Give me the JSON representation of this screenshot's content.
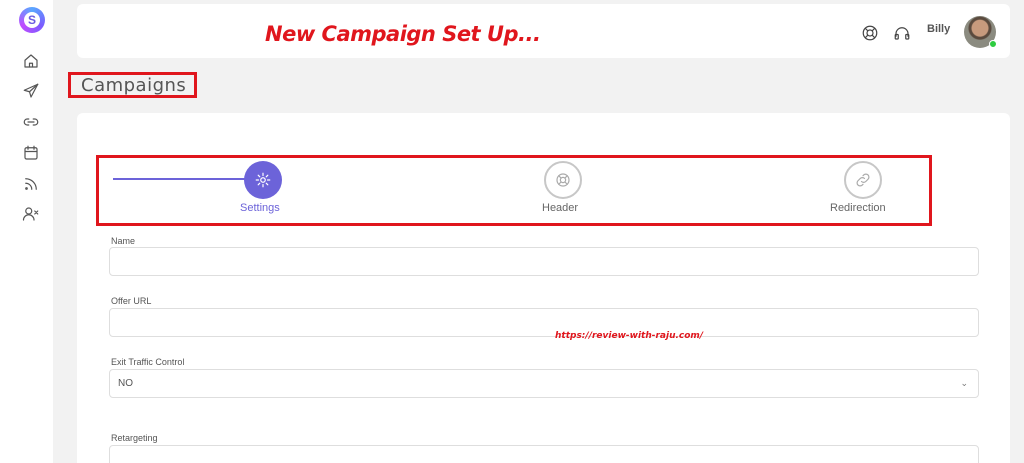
{
  "logo": {
    "glyph": "S"
  },
  "sidebar": {
    "items": [
      {
        "name": "home-icon"
      },
      {
        "name": "send-icon"
      },
      {
        "name": "link-icon"
      },
      {
        "name": "calendar-icon"
      },
      {
        "name": "rss-icon"
      },
      {
        "name": "user-x-icon"
      }
    ]
  },
  "topbar": {
    "banner": "New Campaign Set Up...",
    "username": "Billy"
  },
  "page": {
    "title": "Campaigns"
  },
  "stepper": {
    "steps": [
      {
        "label": "Settings",
        "icon": "gear-icon",
        "active": true
      },
      {
        "label": "Header",
        "icon": "lifebuoy-icon",
        "active": false
      },
      {
        "label": "Redirection",
        "icon": "link-icon",
        "active": false
      }
    ]
  },
  "form": {
    "name_label": "Name",
    "name_value": "",
    "offer_url_label": "Offer URL",
    "offer_url_value": "",
    "exit_traffic_label": "Exit Traffic Control",
    "exit_traffic_value": "NO",
    "retargeting_label": "Retargeting",
    "retargeting_value": ""
  },
  "watermark": "https://review-with-raju.com/",
  "colors": {
    "accent": "#6c63d9",
    "annotation": "#e0161d",
    "online": "#2ecc40"
  }
}
